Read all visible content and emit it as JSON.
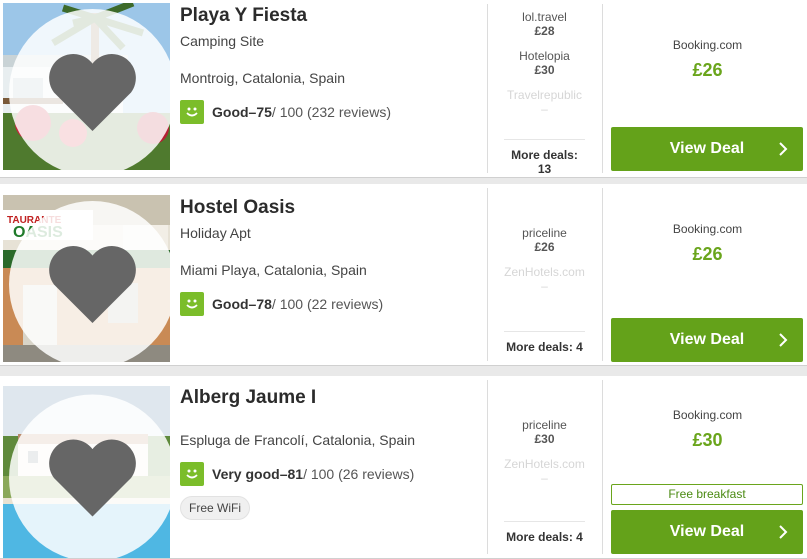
{
  "colors": {
    "accent_green": "#64a21a",
    "price_green": "#6aa51c",
    "rating_green": "#7bbd2a"
  },
  "hotels": [
    {
      "name": "Playa Y Fiesta",
      "type": "Camping Site",
      "location": "Montroig, Catalonia, Spain",
      "rating_word": "Good",
      "rating_sep": " – ",
      "score": "75",
      "score_suffix": " / 100 (232 reviews)",
      "deals": [
        {
          "provider": "lol.travel",
          "price": "£28",
          "available": true
        },
        {
          "provider": "Hotelopia",
          "price": "£30",
          "available": true
        },
        {
          "provider": "Travelrepublic",
          "price": "–",
          "available": false
        }
      ],
      "more_deals": "More deals: 13",
      "best_provider": "Booking.com",
      "best_price": "£26",
      "cta": "View Deal"
    },
    {
      "name": "Hostel Oasis",
      "type": "Holiday Apt",
      "location": "Miami Playa, Catalonia, Spain",
      "rating_word": "Good",
      "rating_sep": " – ",
      "score": "78",
      "score_suffix": " / 100 (22 reviews)",
      "deals": [
        {
          "provider": "priceline",
          "price": "£26",
          "available": true
        },
        {
          "provider": "ZenHotels.com",
          "price": "–",
          "available": false
        }
      ],
      "more_deals": "More deals: 4",
      "best_provider": "Booking.com",
      "best_price": "£26",
      "cta": "View Deal"
    },
    {
      "name": "Alberg Jaume I",
      "type": "",
      "location": "Espluga de Francolí, Catalonia, Spain",
      "rating_word": "Very good",
      "rating_sep": " – ",
      "score": "81",
      "score_suffix": " / 100 (26 reviews)",
      "amenity": "Free WiFi",
      "deals": [
        {
          "provider": "priceline",
          "price": "£30",
          "available": true
        },
        {
          "provider": "ZenHotels.com",
          "price": "–",
          "available": false
        }
      ],
      "more_deals": "More deals: 4",
      "best_provider": "Booking.com",
      "best_price": "£30",
      "perk": "Free breakfast",
      "cta": "View Deal"
    }
  ]
}
